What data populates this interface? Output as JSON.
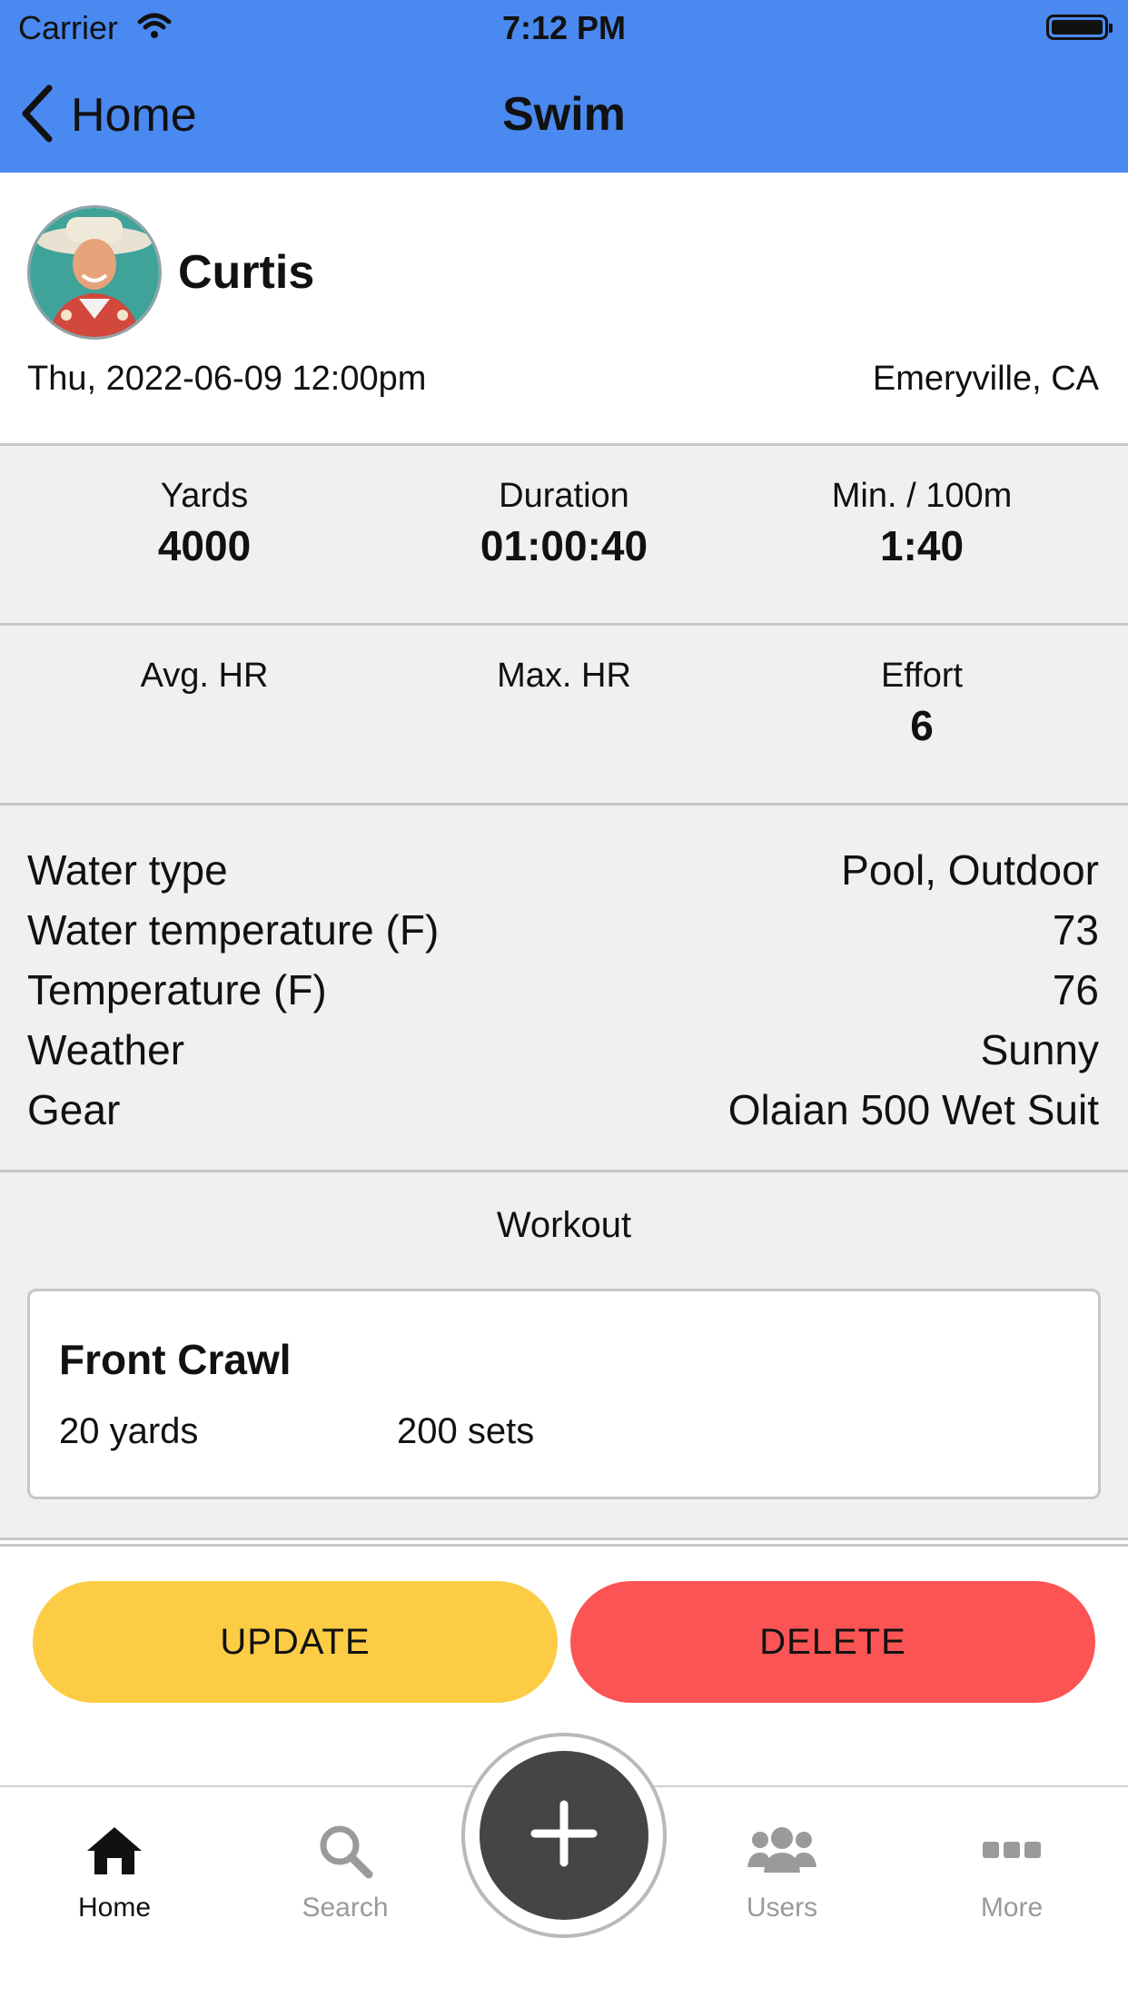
{
  "status_bar": {
    "carrier": "Carrier",
    "time": "7:12 PM"
  },
  "nav": {
    "back_label": "Home",
    "title": "Swim"
  },
  "activity": {
    "user_name": "Curtis",
    "datetime": "Thu, 2022-06-09 12:00pm",
    "location": "Emeryville, CA"
  },
  "stats_row1": [
    {
      "label": "Yards",
      "value": "4000"
    },
    {
      "label": "Duration",
      "value": "01:00:40"
    },
    {
      "label": "Min. / 100m",
      "value": "1:40"
    }
  ],
  "stats_row2": [
    {
      "label": "Avg. HR",
      "value": ""
    },
    {
      "label": "Max. HR",
      "value": ""
    },
    {
      "label": "Effort",
      "value": "6"
    }
  ],
  "attributes": [
    {
      "label": "Water type",
      "value": "Pool, Outdoor"
    },
    {
      "label": "Water temperature (F)",
      "value": "73"
    },
    {
      "label": "Temperature (F)",
      "value": "76"
    },
    {
      "label": "Weather",
      "value": "Sunny"
    },
    {
      "label": "Gear",
      "value": "Olaian 500 Wet Suit"
    }
  ],
  "workout": {
    "title": "Workout",
    "exercises": [
      {
        "name": "Front Crawl",
        "distance": "20 yards",
        "sets": "200 sets"
      }
    ]
  },
  "actions": {
    "update_label": "UPDATE",
    "delete_label": "DELETE"
  },
  "tabbar": {
    "tabs": [
      {
        "label": "Home",
        "icon": "home-icon",
        "active": true
      },
      {
        "label": "Search",
        "icon": "search-icon",
        "active": false
      },
      {
        "label": "Users",
        "icon": "users-icon",
        "active": false
      },
      {
        "label": "More",
        "icon": "more-icon",
        "active": false
      }
    ],
    "add_icon": "plus-icon"
  },
  "colors": {
    "header": "#4a89f0",
    "band": "#f0f0f0",
    "update": "#fccc45",
    "delete": "#fc5454",
    "fab": "#454545",
    "tab_active": "#111111",
    "tab_inactive": "#9a9a9a"
  }
}
